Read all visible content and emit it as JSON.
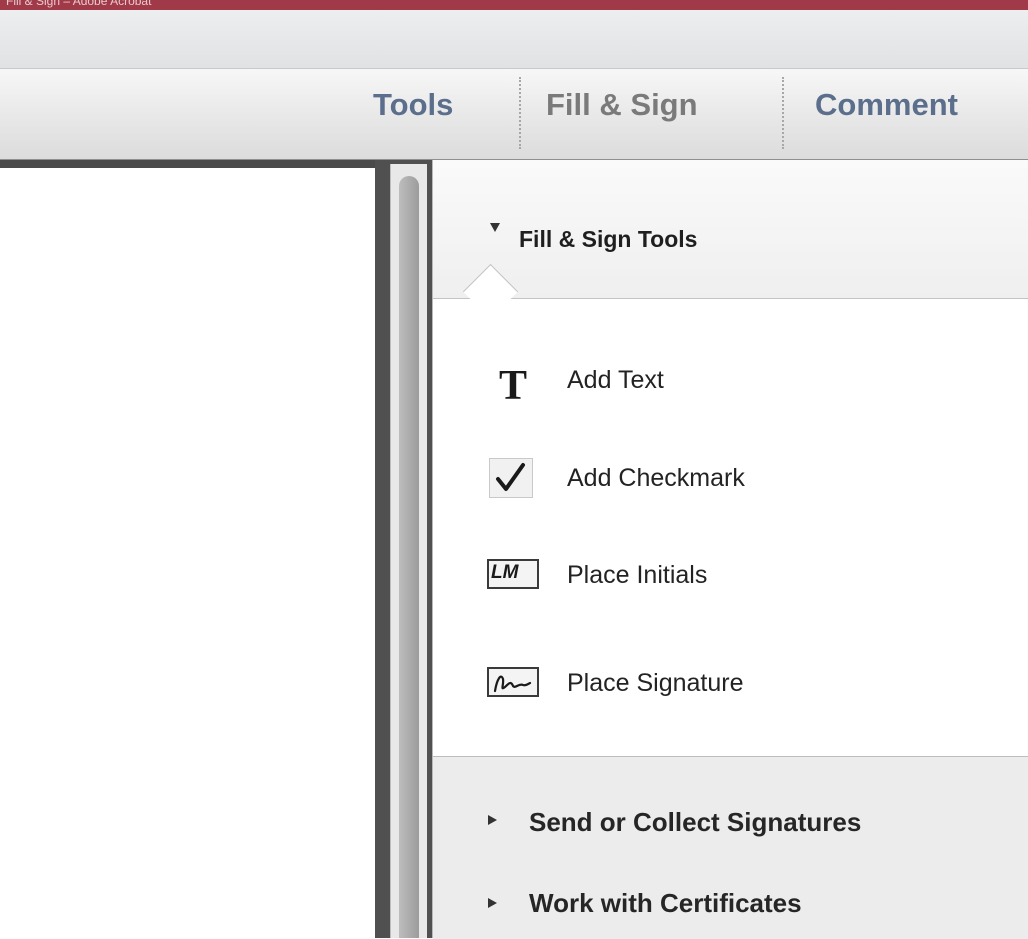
{
  "window": {
    "title_fragment": "Fill & Sign – Adobe Acrobat"
  },
  "tabs": [
    {
      "label": "Tools",
      "color": "#5b6e8b"
    },
    {
      "label": "Fill & Sign",
      "color": "#7a7a7a"
    },
    {
      "label": "Comment",
      "color": "#5b6e8b"
    }
  ],
  "panel": {
    "section_title": "Fill & Sign Tools",
    "tools": [
      {
        "label": "Add Text",
        "icon": "text-T-icon"
      },
      {
        "label": "Add Checkmark",
        "icon": "checkmark-icon"
      },
      {
        "label": "Place Initials",
        "icon": "initials-icon",
        "icon_text": "LM"
      },
      {
        "label": "Place Signature",
        "icon": "signature-icon"
      }
    ],
    "collapsed_sections": [
      {
        "label": "Send or Collect Signatures"
      },
      {
        "label": "Work with Certificates"
      }
    ]
  }
}
